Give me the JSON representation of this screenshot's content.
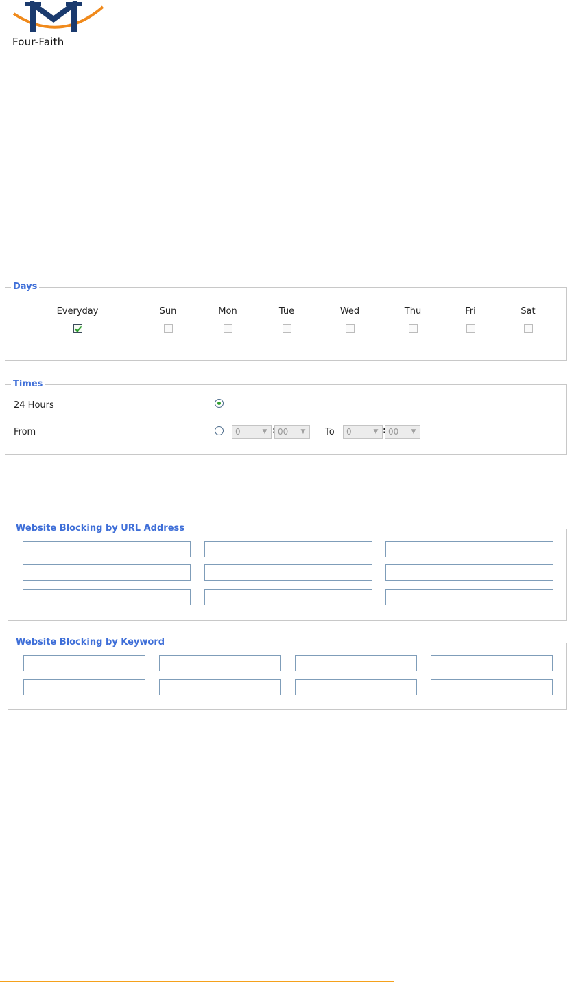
{
  "brand": {
    "name": "Four-Faith",
    "colors": {
      "logo_navy": "#1a3a6e",
      "logo_orange": "#f08a1c",
      "legend_blue": "#3f6fd8",
      "footer_orange": "#f5a11c"
    }
  },
  "days": {
    "legend": "Days",
    "items": [
      {
        "label": "Everyday",
        "checked": true
      },
      {
        "label": "Sun",
        "checked": false
      },
      {
        "label": "Mon",
        "checked": false
      },
      {
        "label": "Tue",
        "checked": false
      },
      {
        "label": "Wed",
        "checked": false
      },
      {
        "label": "Thu",
        "checked": false
      },
      {
        "label": "Fri",
        "checked": false
      },
      {
        "label": "Sat",
        "checked": false
      }
    ]
  },
  "times": {
    "legend": "Times",
    "hours24_label": "24 Hours",
    "hours24_selected": true,
    "from_label": "From",
    "from_selected": false,
    "from_hour": "0",
    "from_minute": "00",
    "to_label": "To",
    "to_hour": "0",
    "to_minute": "00"
  },
  "url_block": {
    "legend": "Website Blocking by URL Address",
    "fields": [
      "",
      "",
      "",
      "",
      "",
      "",
      "",
      "",
      ""
    ]
  },
  "keyword_block": {
    "legend": "Website Blocking by Keyword",
    "fields": [
      "",
      "",
      "",
      "",
      "",
      "",
      "",
      ""
    ]
  }
}
